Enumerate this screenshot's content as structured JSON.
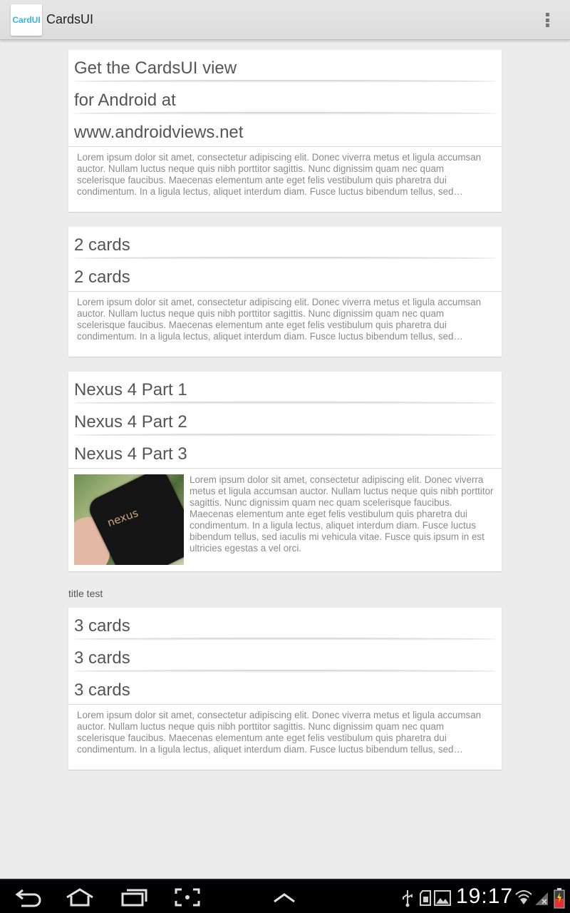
{
  "app": {
    "icon_label": "CardUI",
    "title": "CardsUI"
  },
  "stacks": [
    {
      "titles": [
        "Get the CardsUI view",
        "for Android at",
        "www.androidviews.net"
      ],
      "body": "Lorem ipsum dolor sit amet, consectetur adipiscing elit. Donec viverra metus et ligula accumsan auctor. Nullam luctus neque quis nibh porttitor sagittis. Nunc dignissim quam nec quam scelerisque faucibus. Maecenas elementum ante eget felis vestibulum quis pharetra dui condimentum. In a ligula lectus, aliquet interdum diam. Fusce luctus bibendum tellus, sed…"
    },
    {
      "titles": [
        "2 cards",
        "2 cards"
      ],
      "body": "Lorem ipsum dolor sit amet, consectetur adipiscing elit. Donec viverra metus et ligula accumsan auctor. Nullam luctus neque quis nibh porttitor sagittis. Nunc dignissim quam nec quam scelerisque faucibus. Maecenas elementum ante eget felis vestibulum quis pharetra dui condimentum. In a ligula lectus, aliquet interdum diam. Fusce luctus bibendum tellus, sed…"
    },
    {
      "titles": [
        "Nexus 4 Part 1",
        "Nexus 4 Part 2",
        "Nexus 4 Part 3"
      ],
      "image_caption": "nexus",
      "body": "Lorem ipsum dolor sit amet, consectetur adipiscing elit. Donec viverra metus et ligula accumsan auctor. Nullam luctus neque quis nibh porttitor sagittis. Nunc dignissim quam nec quam scelerisque faucibus. Maecenas elementum ante eget felis vestibulum quis pharetra dui condimentum. In a ligula lectus, aliquet interdum diam. Fusce luctus bibendum tellus, sed iaculis mi vehicula vitae. Fusce quis ipsum in est ultricies egestas a vel orci."
    },
    {
      "section_title": "title test",
      "titles": [
        "3 cards",
        "3 cards",
        "3 cards"
      ],
      "body": "Lorem ipsum dolor sit amet, consectetur adipiscing elit. Donec viverra metus et ligula accumsan auctor. Nullam luctus neque quis nibh porttitor sagittis. Nunc dignissim quam nec quam scelerisque faucibus. Maecenas elementum ante eget felis vestibulum quis pharetra dui condimentum. In a ligula lectus, aliquet interdum diam. Fusce luctus bibendum tellus, sed…"
    }
  ],
  "navbar": {
    "buttons": [
      "back-icon",
      "home-icon",
      "recent-apps-icon",
      "screenshot-icon",
      "expand-icon"
    ],
    "status_icons": [
      "usb-icon",
      "sd-card-icon",
      "image-icon",
      "wifi-icon",
      "signal-icon",
      "battery-icon"
    ],
    "clock": "19:17"
  },
  "colors": {
    "background": "#ececec",
    "card": "#ffffff",
    "title_text": "#555555",
    "body_text": "#8a8a8a",
    "accent": "#33b5e5"
  }
}
